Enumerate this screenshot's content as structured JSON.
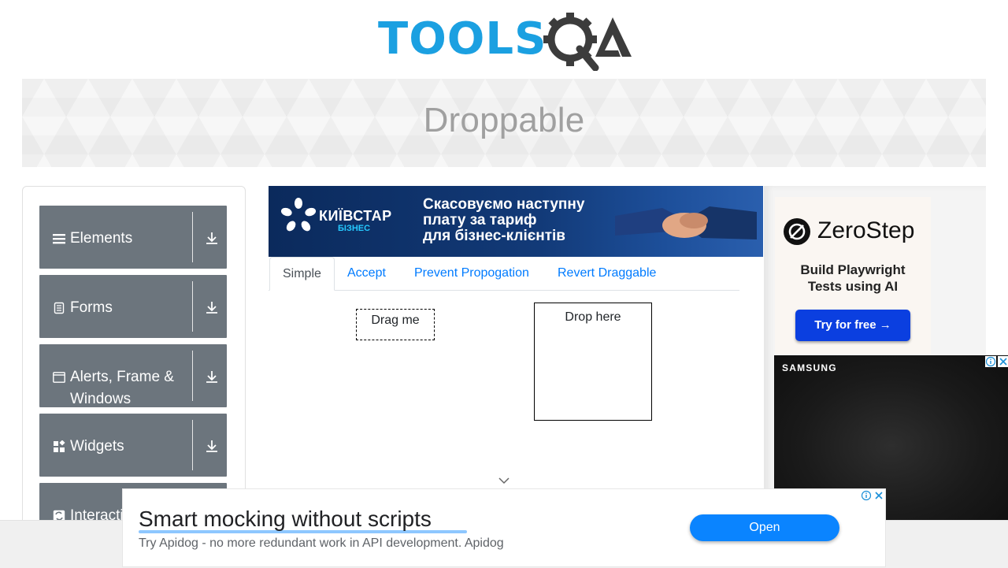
{
  "header": {
    "logo_alt": "TOOLSQA",
    "page_title": "Droppable"
  },
  "sidebar": {
    "groups": [
      {
        "label": "Elements",
        "icon": "menu-icon"
      },
      {
        "label": "Forms",
        "icon": "document-icon"
      },
      {
        "label": "Alerts, Frame & Windows",
        "icon": "window-icon"
      },
      {
        "label": "Widgets",
        "icon": "widgets-icon"
      },
      {
        "label": "Interactions",
        "icon": "interactions-icon"
      }
    ]
  },
  "ads": {
    "kyivstar": {
      "brand": "КИЇВСТАР",
      "sub": "БІЗНЕС",
      "line1": "Скасовуємо наступну",
      "line2": "плату за тариф",
      "line3": "для бізнес-клієнтів"
    },
    "zerostep": {
      "name": "ZeroStep",
      "line1": "Build Playwright",
      "line2": "Tests using AI",
      "cta": "Try for free →"
    },
    "samsung": {
      "brand": "SAMSUNG"
    },
    "apidog": {
      "headline": "Smart mocking without scripts",
      "sub": "Try Apidog - no more redundant work in API development. Apidog",
      "cta": "Open"
    }
  },
  "tabs": [
    {
      "label": "Simple",
      "active": true
    },
    {
      "label": "Accept",
      "active": false
    },
    {
      "label": "Prevent Propogation",
      "active": false
    },
    {
      "label": "Revert Draggable",
      "active": false
    }
  ],
  "simple": {
    "drag_label": "Drag me",
    "drop_label": "Drop here"
  },
  "colors": {
    "logo_blue": "#1ba0e1",
    "logo_dark": "#3c3c3c",
    "sidebar_group_bg": "#6c757d",
    "tab_link": "#007bff",
    "zerostep_button": "#0b3fe0",
    "apidog_button": "#0a84ff"
  }
}
